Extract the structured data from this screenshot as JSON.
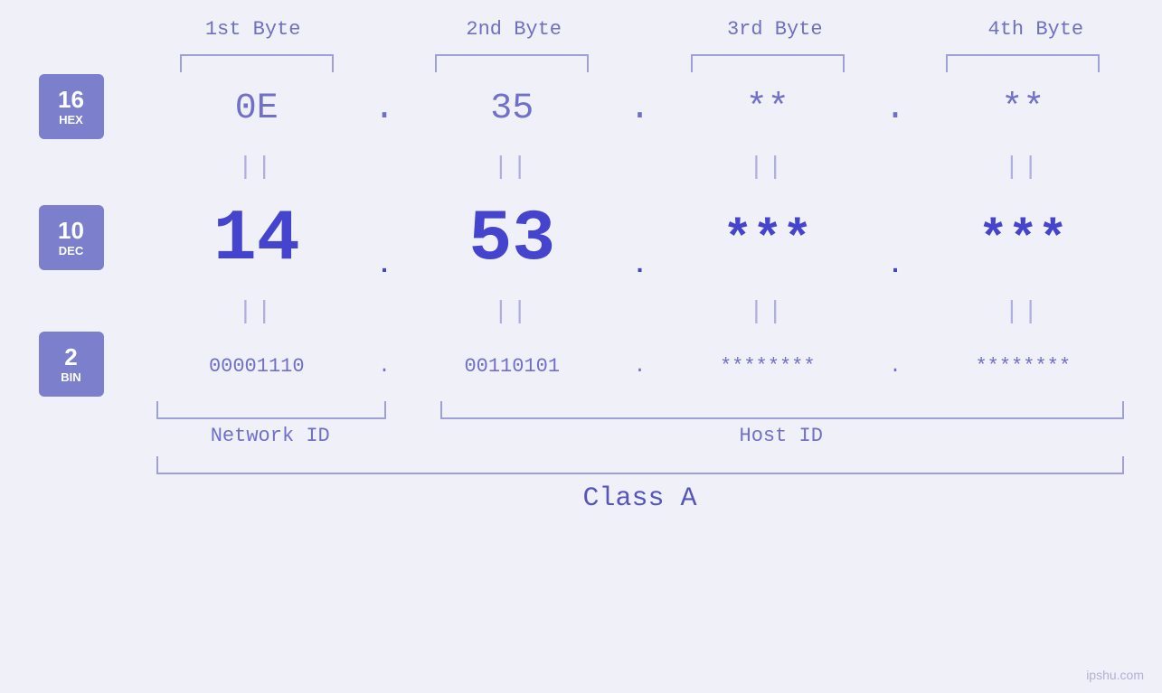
{
  "headers": {
    "byte1": "1st Byte",
    "byte2": "2nd Byte",
    "byte3": "3rd Byte",
    "byte4": "4th Byte"
  },
  "badges": {
    "hex_num": "16",
    "hex_label": "HEX",
    "dec_num": "10",
    "dec_label": "DEC",
    "bin_num": "2",
    "bin_label": "BIN"
  },
  "values": {
    "hex": [
      "0E",
      "35",
      "**",
      "**"
    ],
    "dec": [
      "14",
      "53",
      "***",
      "***"
    ],
    "bin": [
      "00001110",
      "00110101",
      "********",
      "********"
    ]
  },
  "separators": {
    "dot": ".",
    "equals": "||"
  },
  "labels": {
    "network_id": "Network ID",
    "host_id": "Host ID",
    "class": "Class A"
  },
  "watermark": "ipshu.com"
}
